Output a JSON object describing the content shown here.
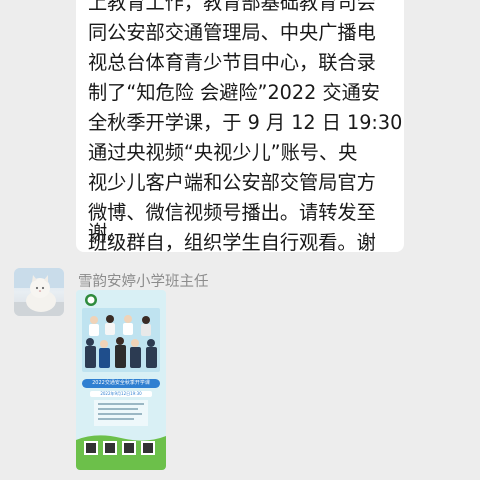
{
  "message": {
    "lines": [
      "上教育工作，教育部基础教育司会",
      "同公安部交通管理局、中央广播电",
      "视总台体育青少节目中心，联合录",
      "制了“知危险 会避险”2022 交通安",
      "全秋季开学课，于 9 月 12 日 19:30",
      "通过央视频“央视少儿”账号、央",
      "视少儿客户端和公安部交管局官方",
      "微博、微信视频号播出。请转发至",
      "班级群自，组织学生自行观看。谢",
      "谢。"
    ]
  },
  "sender": {
    "name": "雪韵安婷小学班主任",
    "avatar_icon": "cat-photo-avatar"
  },
  "poster": {
    "title": "2022交通安全秋季开学课",
    "date": "2022年9月12日19:30",
    "colors": {
      "sky": "#d9f0f5",
      "banner": "#2f7fd1",
      "grass": "#6cc04a",
      "logo": "#2e8b3d"
    }
  }
}
